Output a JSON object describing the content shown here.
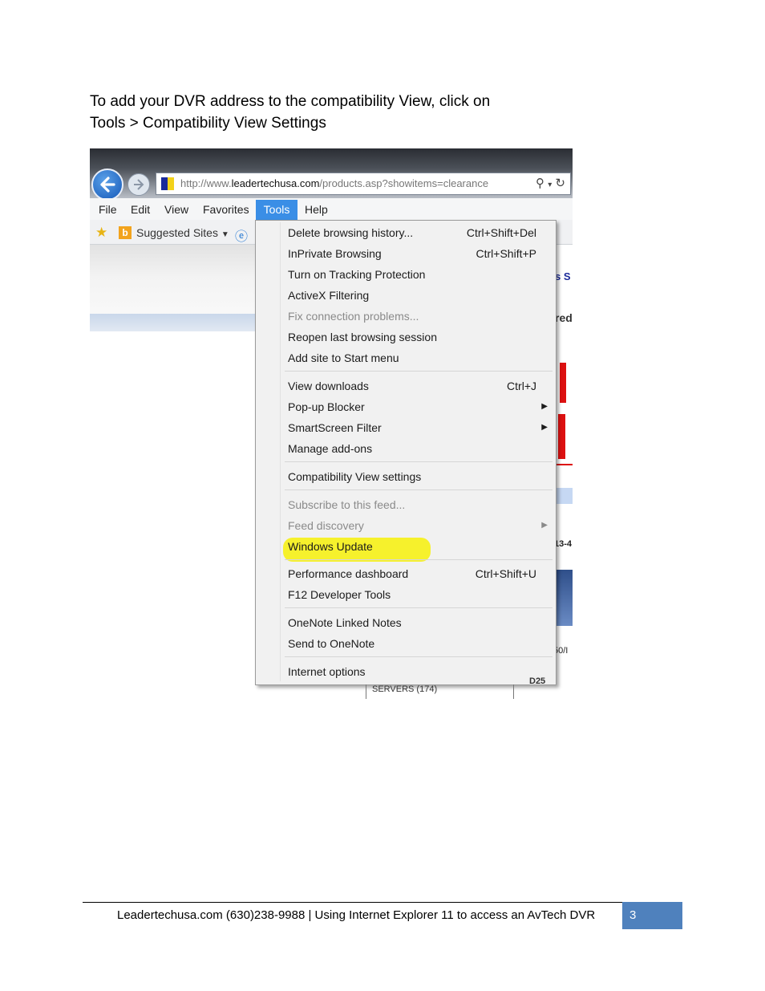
{
  "intro": {
    "line1": "To add your DVR address to the compatibility View, click on",
    "line2": "Tools > Compatibility View Settings"
  },
  "browser": {
    "url_prefix": "http://www.",
    "url_domain": "leadertechusa.com",
    "url_path": "/products.asp?showitems=clearance",
    "menus": [
      "File",
      "Edit",
      "View",
      "Favorites",
      "Tools",
      "Help"
    ],
    "favorites_bar": {
      "suggested_sites": "Suggested Sites"
    },
    "tools_menu": [
      {
        "label": "Delete browsing history...",
        "shortcut": "Ctrl+Shift+Del"
      },
      {
        "label": "InPrivate Browsing",
        "shortcut": "Ctrl+Shift+P"
      },
      {
        "label": "Turn on Tracking Protection"
      },
      {
        "label": "ActiveX Filtering"
      },
      {
        "label": "Fix connection problems...",
        "disabled": true
      },
      {
        "label": "Reopen last browsing session"
      },
      {
        "label": "Add site to Start menu"
      },
      {
        "label": "View downloads",
        "shortcut": "Ctrl+J"
      },
      {
        "label": "Pop-up Blocker",
        "submenu": true
      },
      {
        "label": "SmartScreen Filter",
        "submenu": true
      },
      {
        "label": "Manage add-ons"
      },
      {
        "label": "Compatibility View settings",
        "highlighted": true
      },
      {
        "label": "Subscribe to this feed...",
        "disabled": true
      },
      {
        "label": "Feed discovery",
        "disabled": true,
        "submenu": true
      },
      {
        "label": "Windows Update"
      },
      {
        "label": "Performance dashboard",
        "shortcut": "Ctrl+Shift+U"
      },
      {
        "label": "F12 Developer Tools"
      },
      {
        "label": "OneNote Linked Notes"
      },
      {
        "label": "Send to OneNote"
      },
      {
        "label": "Internet options"
      }
    ],
    "background_text": {
      "s_s": "s S",
      "red": "red",
      "servers": "SERVERS (174)",
      "frag_3_4": "13-4",
      "frag_50": "50/I",
      "frag_d25": "D25"
    },
    "highlight_color": "#f6f12c"
  },
  "footer": {
    "text": "Leadertechusa.com  (630)238-9988 | Using Internet Explorer 11 to access an AvTech DVR",
    "page_number": "3",
    "accent_color": "#4f81bd"
  }
}
